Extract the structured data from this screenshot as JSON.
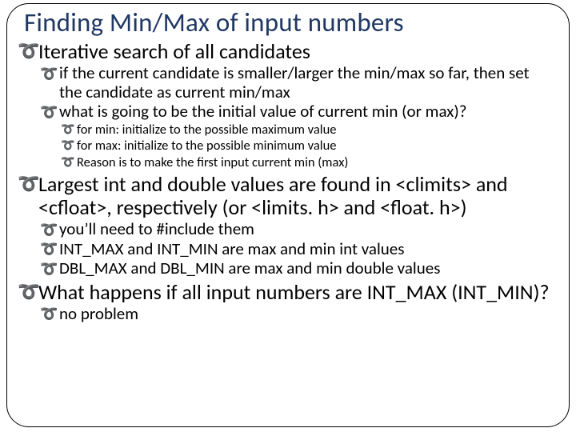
{
  "title": "Finding Min/Max of input numbers",
  "l1_1": "Iterative search of all candidates",
  "l2_1": "if the current candidate is smaller/larger the min/max so far, then set the candidate as current min/max",
  "l2_2": "what is going to be the initial value of current min (or max)?",
  "l3_1": "for min: initialize to the possible maximum value",
  "l3_2": "for max: initialize to the possible minimum value",
  "l3_3": "Reason is to make the first input current min (max)",
  "l1_2": "Largest int and double values are found in <climits> and <cfloat>, respectively (or <limits. h> and <float. h>)",
  "l2_3": "you’ll need to #include them",
  "l2_4": "INT_MAX and INT_MIN are max and min int values",
  "l2_5": "DBL_MAX and DBL_MIN are max and min double values",
  "l1_3": "What happens if all input numbers are INT_MAX (INT_MIN)?",
  "l2_6": "no problem"
}
